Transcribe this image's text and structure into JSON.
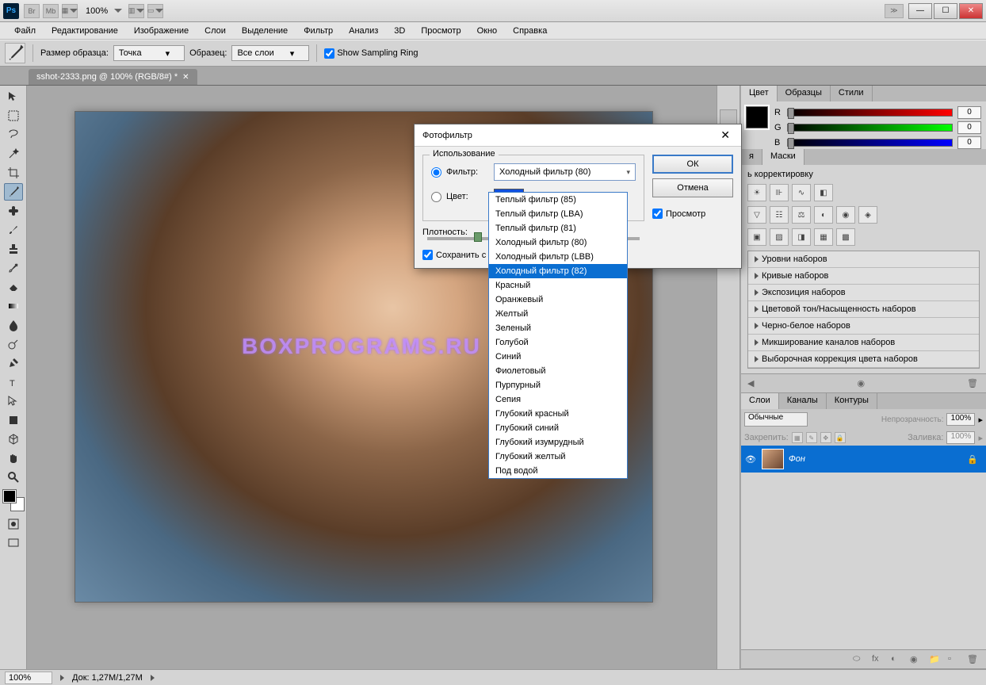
{
  "titlebar": {
    "app": "Ps",
    "zoom": "100%",
    "icons": [
      "Br",
      "Mb"
    ],
    "win": {
      "min": "—",
      "max": "☐",
      "close": "✕"
    }
  },
  "menubar": [
    "Файл",
    "Редактирование",
    "Изображение",
    "Слои",
    "Выделение",
    "Фильтр",
    "Анализ",
    "3D",
    "Просмотр",
    "Окно",
    "Справка"
  ],
  "optbar": {
    "sample_size_label": "Размер образца:",
    "sample_size_value": "Точка",
    "sample_label": "Образец:",
    "sample_value": "Все слои",
    "show_ring": "Show Sampling Ring"
  },
  "doctab": {
    "title": "sshot-2333.png @ 100% (RGB/8#) *"
  },
  "watermark": "BOXPROGRAMS.RU",
  "panels": {
    "color": {
      "tabs": [
        "Цвет",
        "Образцы",
        "Стили"
      ],
      "r": "0",
      "g": "0",
      "b": "0"
    },
    "adjustments": {
      "tabs": [
        "я",
        "Маски"
      ],
      "label": "ь корректировку",
      "presets": [
        "Уровни наборов",
        "Кривые наборов",
        "Экспозиция наборов",
        "Цветовой тон/Насыщенность наборов",
        "Черно-белое наборов",
        "Микширование каналов наборов",
        "Выборочная коррекция цвета наборов"
      ]
    },
    "layers": {
      "tabs": [
        "Слои",
        "Каналы",
        "Контуры"
      ],
      "blend": "Обычные",
      "opacity_label": "Непрозрачность:",
      "opacity_value": "100%",
      "lock_label": "Закрепить:",
      "fill_label": "Заливка:",
      "fill_value": "100%",
      "layer_name": "Фон"
    }
  },
  "dialog": {
    "title": "Фотофильтр",
    "fieldset": "Использование",
    "filter_label": "Фильтр:",
    "filter_value": "Холодный фильтр (80)",
    "color_label": "Цвет:",
    "density_label": "Плотность:",
    "preserve_label": "Сохранить с",
    "ok": "ОК",
    "cancel": "Отмена",
    "preview": "Просмотр"
  },
  "dropdown": {
    "items": [
      "Теплый фильтр (85)",
      "Теплый фильтр (LBA)",
      "Теплый фильтр (81)",
      "Холодный фильтр (80)",
      "Холодный фильтр (LBB)",
      "Холодный фильтр (82)",
      "Красный",
      "Оранжевый",
      "Желтый",
      "Зеленый",
      "Голубой",
      "Синий",
      "Фиолетовый",
      "Пурпурный",
      "Сепия",
      "Глубокий красный",
      "Глубокий синий",
      "Глубокий изумрудный",
      "Глубокий желтый",
      "Под водой"
    ],
    "selected_index": 5
  },
  "statusbar": {
    "zoom": "100%",
    "doc": "Док: 1,27M/1,27M"
  }
}
